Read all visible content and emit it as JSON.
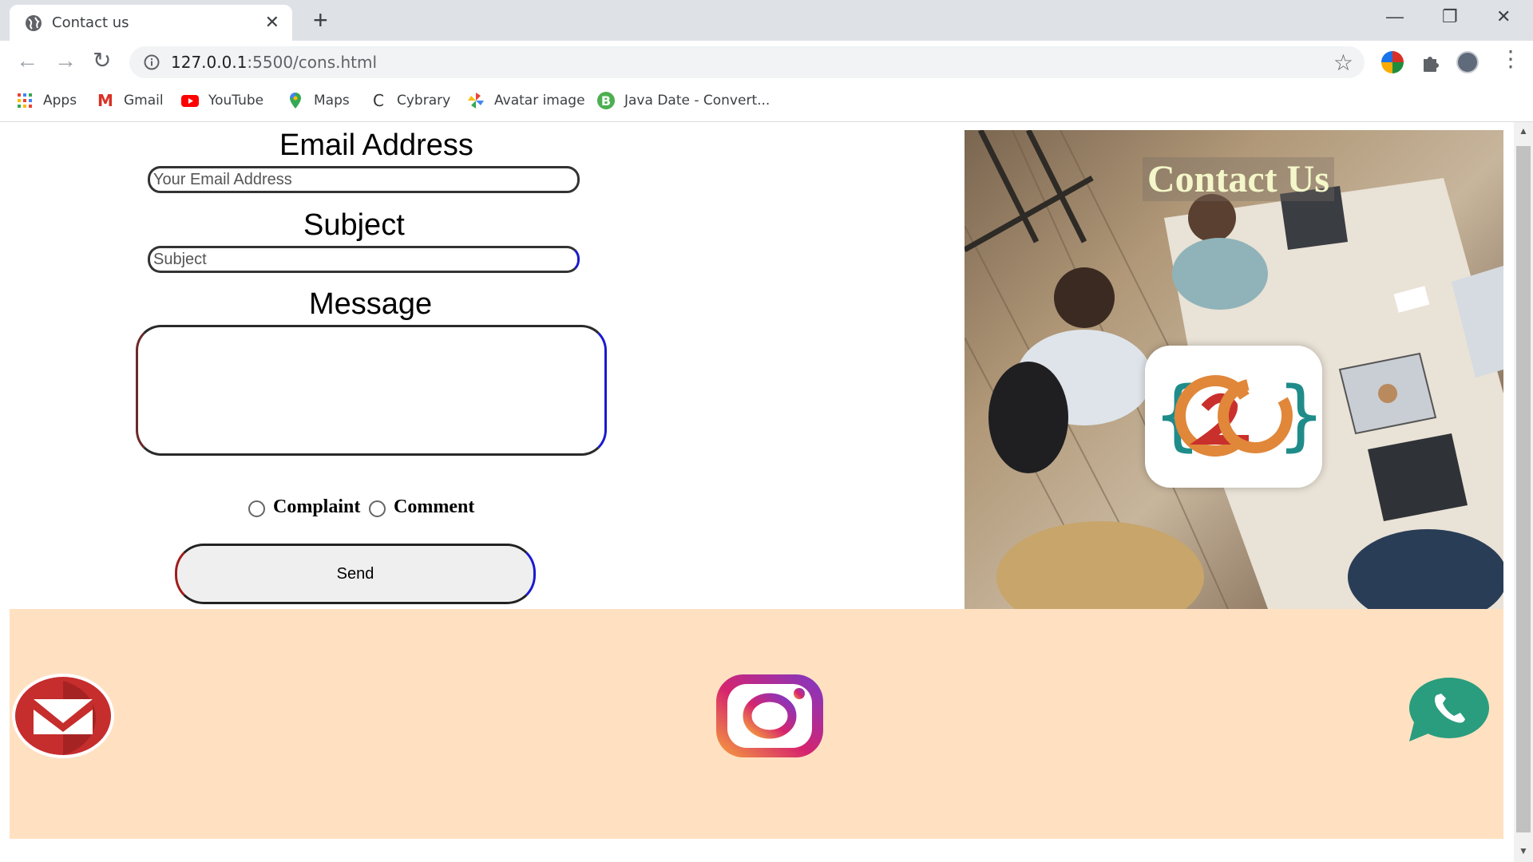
{
  "browser": {
    "tab_title": "Contact us",
    "tab_close": "✕",
    "new_tab": "+",
    "window_controls": {
      "minimize": "—",
      "restore": "❐",
      "close": "✕"
    },
    "nav": {
      "back": "←",
      "forward": "→",
      "reload": "↻"
    },
    "url_host": "127.0.0.1",
    "url_rest": ":5500/cons.html",
    "star": "☆",
    "menu": "⋮",
    "bookmarks": [
      {
        "label": "Apps",
        "icon": "apps-grid-icon"
      },
      {
        "label": "Gmail",
        "icon": "gmail-icon"
      },
      {
        "label": "YouTube",
        "icon": "youtube-icon"
      },
      {
        "label": "Maps",
        "icon": "maps-icon"
      },
      {
        "label": "Cybrary",
        "icon": "cybrary-icon"
      },
      {
        "label": "Avatar image",
        "icon": "pinwheel-icon"
      },
      {
        "label": "Java Date - Convert...",
        "icon": "b-icon"
      }
    ]
  },
  "form": {
    "email_label": "Email Address",
    "email_placeholder": "Your Email Address",
    "subject_label": "Subject",
    "subject_placeholder": "Subject",
    "message_label": "Message",
    "radio_complaint": "Complaint",
    "radio_comment": "Comment",
    "send_label": "Send"
  },
  "hero": {
    "title": "Contact Us",
    "logo_text": "{C2G}"
  },
  "colors": {
    "footer_bg": "#ffe1c2",
    "hero_title": "#f4f7c9",
    "gmail_red": "#c62d2d",
    "whatsapp_green": "#2a9d7e"
  },
  "footer_icons": [
    "gmail-icon",
    "instagram-icon",
    "whatsapp-icon"
  ]
}
